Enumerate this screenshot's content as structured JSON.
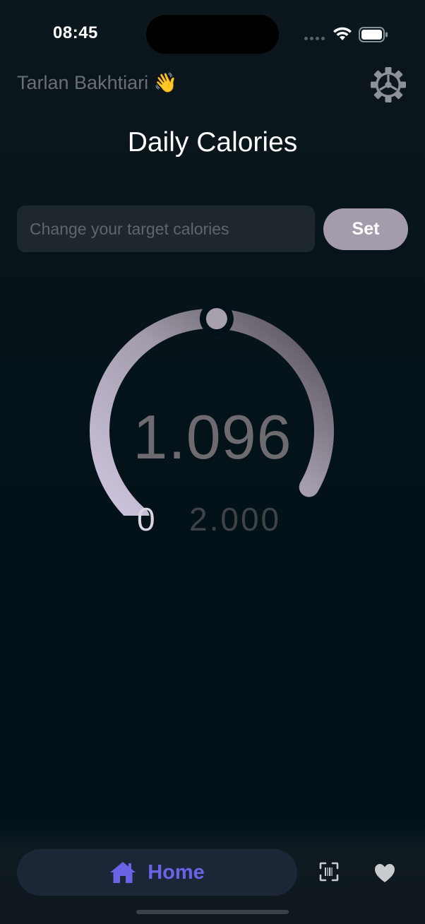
{
  "status_bar": {
    "time": "08:45"
  },
  "header": {
    "user_name": "Tarlan Bakhtiari",
    "wave_emoji": "👋",
    "settings_icon": "gear-icon"
  },
  "title": "Daily Calories",
  "target_input": {
    "placeholder": "Change your target calories",
    "value": ""
  },
  "set_button": {
    "label": "Set"
  },
  "gauge": {
    "value": "1.096",
    "min_label": "0",
    "max_label": "2.000",
    "current": 1096,
    "min": 0,
    "max": 2000
  },
  "bottom_nav": {
    "home_label": "Home",
    "home_icon": "home-icon",
    "scan_icon": "barcode-scan-icon",
    "favorites_icon": "heart-icon"
  },
  "colors": {
    "background": "#031219",
    "accent": "#6a63e6",
    "button": "#a49cad",
    "gauge_start": "#cfc6e0",
    "gauge_end": "#4e4a51"
  }
}
